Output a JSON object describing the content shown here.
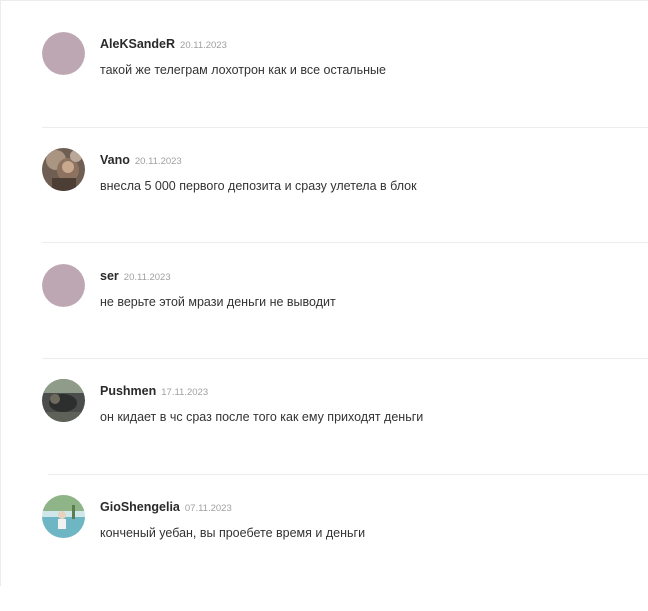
{
  "comments": [
    {
      "author": "AleKSandeR",
      "date": "20.11.2023",
      "text": "такой же телеграм лохотрон как и все остальные",
      "avatar": "default-avatar-icon",
      "avatar_color": "#bda7b2"
    },
    {
      "author": "Vano",
      "date": "20.11.2023",
      "text": "внесла 5 000 первого депозита и сразу улетела в блок",
      "avatar": "user-photo-avatar",
      "avatar_color": "#7a6a5e"
    },
    {
      "author": "ser",
      "date": "20.11.2023",
      "text": "не верьте этой мрази деньги не выводит",
      "avatar": "default-avatar-icon",
      "avatar_color": "#bda7b2"
    },
    {
      "author": "Pushmen",
      "date": "17.11.2023",
      "text": "он кидает в чс сраз после того как ему приходят деньги",
      "avatar": "user-photo-avatar",
      "avatar_color": "#4b4e4a"
    },
    {
      "author": "GioShengelia",
      "date": "07.11.2023",
      "text": "конченый уебан, вы проебете время и деньги",
      "avatar": "user-photo-avatar",
      "avatar_color": "#7fb8bf"
    }
  ]
}
